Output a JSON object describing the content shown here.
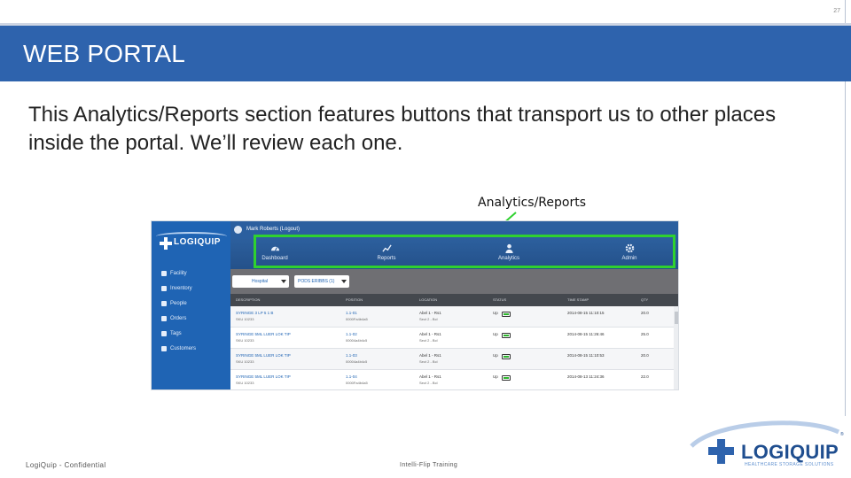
{
  "slide": {
    "page_number": "27",
    "title": "WEB PORTAL",
    "body": "This Analytics/Reports section features buttons that transport us to other places inside the portal.  We’ll review each one.",
    "callout_label": "Analytics/Reports",
    "footer_left": "LogiQuip - Confidential",
    "footer_mid": "Intelli-Flip Training"
  },
  "logo": {
    "word": "LOGIQUIP",
    "tagline": "HEALTHCARE STORAGE SOLUTIONS",
    "reg": "®"
  },
  "screenshot": {
    "sidebar": {
      "logo": "LOGIQUIP",
      "items": [
        "Facility",
        "Inventory",
        "People",
        "Orders",
        "Tags",
        "Customers"
      ]
    },
    "user": "Mark Roberts (Logout)",
    "nav": [
      "Dashboard",
      "Reports",
      "Analytics",
      "Admin"
    ],
    "filters": {
      "facility": "Hospital",
      "station": "PODS ERIBBS (1)"
    },
    "table_headers": [
      "DESCRIPTION",
      "POSITION",
      "LOCATION",
      "STATUS",
      "TIME STAMP",
      "QTY"
    ],
    "rows": [
      {
        "description": "SYRINGE 3 LP 5 1 B",
        "sku": "SKU 10233",
        "position": "1.1-01",
        "pos_sub": "0000Fa4b4a5",
        "location": "Abel 1 - Rs1",
        "loc_sub": "Sect 2 - Bcl",
        "status": "Up",
        "time": "2014-08-15 11:10:15",
        "qty": "20.0"
      },
      {
        "description": "SYRINGE 5ML LUER LOK TIP",
        "sku": "SKU 10233",
        "position": "1.1-02",
        "pos_sub": "00004a4b4c5",
        "location": "Abel 1 - Rs1",
        "loc_sub": "Sect 2 - Bcl",
        "status": "Up",
        "time": "2014-08-15 11:26:46",
        "qty": "25.0"
      },
      {
        "description": "SYRINGE 5ML LUER LOK TIP",
        "sku": "SKU 10233",
        "position": "1.1-03",
        "pos_sub": "00004a4b4c5",
        "location": "Abel 1 - Rs1",
        "loc_sub": "Sect 2 - Bcl",
        "status": "Up",
        "time": "2014-08-15 11:10:53",
        "qty": "20.0"
      },
      {
        "description": "SYRINGE 5ML LUER LOK TIP",
        "sku": "SKU 10233",
        "position": "1.1-04",
        "pos_sub": "0000Fa4b4a5",
        "location": "Abel 1 - Rs1",
        "loc_sub": "Sect 2 - Bcl",
        "status": "Up",
        "time": "2014-08-13 11:24:36",
        "qty": "22.0"
      }
    ]
  },
  "colors": {
    "header_band": "#2e63ad",
    "highlight": "#2fd12f",
    "sidebar": "#1f64b4"
  }
}
